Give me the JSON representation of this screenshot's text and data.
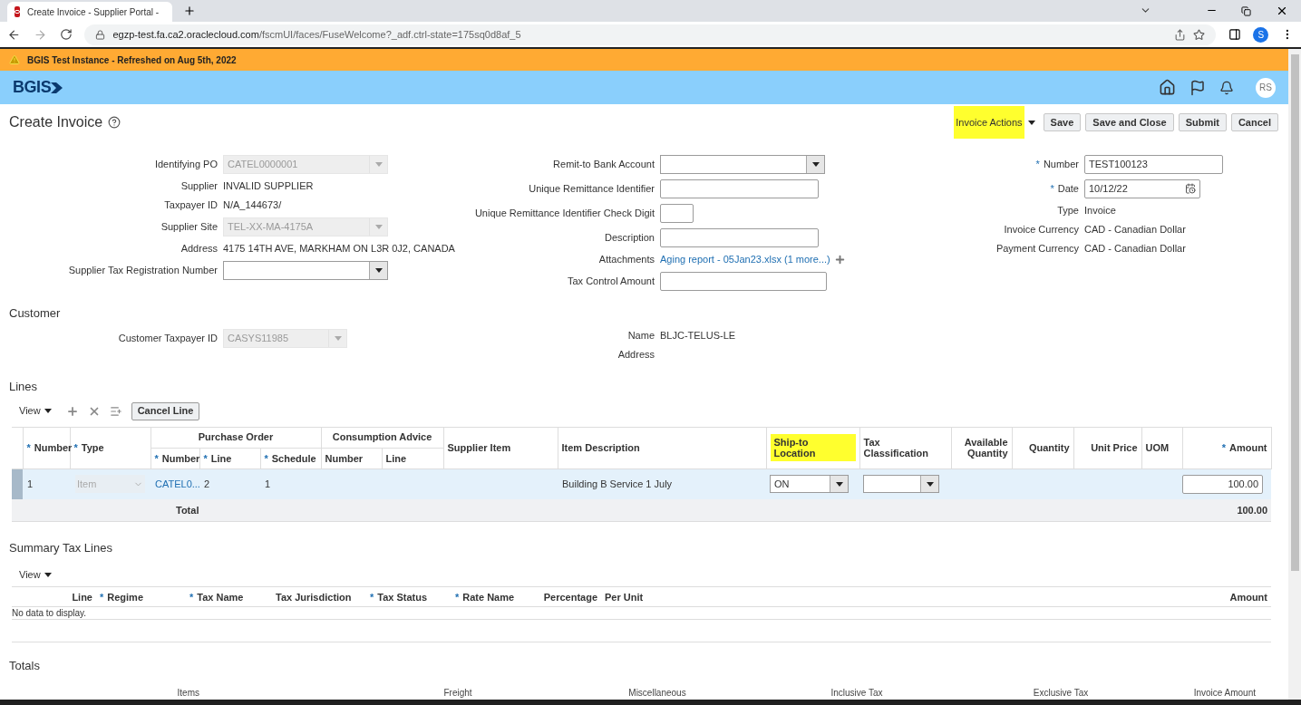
{
  "required_mark": "*",
  "browser": {
    "tab_title": "Create Invoice - Supplier Portal -",
    "url_host": "egzp-test.fa.ca2.oraclecloud.com",
    "url_path": "/fscmUI/faces/FuseWelcome?_adf.ctrl-state=175sq0d8af_5",
    "profile": "S"
  },
  "banner": {
    "text": "BGIS Test Instance - Refreshed on Aug 5th, 2022"
  },
  "header": {
    "logo": "BGIS",
    "avatar": "RS"
  },
  "page": {
    "title": "Create Invoice",
    "actions": [
      {
        "label": "Invoice Actions",
        "kind": "menu",
        "highlighted": true
      },
      {
        "label": "Save",
        "kind": "button",
        "highlighted": false
      },
      {
        "label": "Save and Close",
        "kind": "button",
        "highlighted": false
      },
      {
        "label": "Submit",
        "kind": "button",
        "highlighted": false
      },
      {
        "label": "Cancel",
        "kind": "button",
        "highlighted": false
      }
    ]
  },
  "form": {
    "columns": [
      [
        {
          "label": "Identifying PO",
          "kind": "select",
          "value": "CATEL0000001",
          "disabled": true,
          "required": false
        },
        {
          "label": "Supplier",
          "kind": "text",
          "value": "INVALID SUPPLIER",
          "required": false
        },
        {
          "label": "Taxpayer ID",
          "kind": "text",
          "value": "N/A_144673/",
          "required": false
        },
        {
          "label": "Supplier Site",
          "kind": "select",
          "value": "TEL-XX-MA-4175A",
          "disabled": true,
          "required": false
        },
        {
          "label": "Address",
          "kind": "text",
          "value": "4175 14TH AVE, MARKHAM ON L3R 0J2, CANADA",
          "required": false
        },
        {
          "label": "Supplier Tax Registration Number",
          "kind": "select",
          "disabled": false,
          "required": false
        }
      ],
      [
        {
          "label": "Remit-to Bank Account",
          "kind": "select",
          "disabled": false,
          "required": false
        },
        {
          "label": "Unique Remittance Identifier",
          "kind": "input",
          "required": false
        },
        {
          "label": "Unique Remittance Identifier Check Digit",
          "kind": "input",
          "required": false
        },
        {
          "label": "Description",
          "kind": "input",
          "required": false
        },
        {
          "label": "Attachments",
          "kind": "link",
          "value": "Aging report - 05Jan23.xlsx (1 more...)",
          "required": false
        },
        {
          "label": "Tax Control Amount",
          "kind": "input",
          "required": false
        }
      ],
      [
        {
          "label": "Number",
          "kind": "input",
          "value": "TEST100123",
          "required": true
        },
        {
          "label": "Date",
          "kind": "date",
          "value": "10/12/22",
          "required": true
        },
        {
          "label": "Type",
          "kind": "text",
          "value": "Invoice",
          "required": false
        },
        {
          "label": "Invoice Currency",
          "kind": "text",
          "value": "CAD - Canadian Dollar",
          "required": false
        },
        {
          "label": "Payment Currency",
          "kind": "text",
          "value": "CAD - Canadian Dollar",
          "required": false
        }
      ]
    ]
  },
  "customer": {
    "title": "Customer",
    "columns": [
      [
        {
          "label": "Customer Taxpayer ID",
          "kind": "select",
          "value": "CASYS11985",
          "disabled": true,
          "required": false
        }
      ],
      [
        {
          "label": "Name",
          "kind": "text",
          "value": "BLJC-TELUS-LE",
          "required": false
        },
        {
          "label": "Address",
          "kind": "text",
          "required": false
        }
      ]
    ]
  },
  "lines": {
    "title": "Lines",
    "view": "View",
    "cancel_button": "Cancel Line",
    "groups": [
      {
        "label": "Purchase Order"
      },
      {
        "label": "Consumption Advice"
      }
    ],
    "columns": [
      {
        "label": "Number",
        "required": true,
        "highlighted": false
      },
      {
        "label": "Type",
        "required": true,
        "highlighted": false
      },
      {
        "label": "Number",
        "required": true,
        "highlighted": false
      },
      {
        "label": "Line",
        "required": true,
        "highlighted": false
      },
      {
        "label": "Schedule",
        "required": true,
        "highlighted": false
      },
      {
        "label": "Number",
        "required": false,
        "highlighted": false
      },
      {
        "label": "Line",
        "required": false,
        "highlighted": false
      },
      {
        "label": "Supplier Item",
        "required": false,
        "highlighted": false
      },
      {
        "label": "Item Description",
        "required": false,
        "highlighted": false
      },
      {
        "label": "Ship-to Location",
        "required": false,
        "highlighted": true
      },
      {
        "label": "Tax Classification",
        "required": false,
        "highlighted": false
      },
      {
        "label": "Available Quantity",
        "required": false,
        "highlighted": false
      },
      {
        "label": "Quantity",
        "required": false,
        "highlighted": false
      },
      {
        "label": "Unit Price",
        "required": false,
        "highlighted": false
      },
      {
        "label": "UOM",
        "required": false,
        "highlighted": false
      },
      {
        "label": "Amount",
        "required": true,
        "highlighted": false
      }
    ],
    "rows": [
      {
        "selected": true,
        "number": "1",
        "type": "Item",
        "po_number": "CATEL0...",
        "po_line": "2",
        "po_schedule": "1",
        "item_description": "Building B Service 1 July",
        "ship_to": "ON",
        "amount": "100.00"
      }
    ],
    "total": {
      "label": "Total",
      "amount": "100.00"
    }
  },
  "tax_lines": {
    "title": "Summary Tax Lines",
    "view": "View",
    "columns": [
      {
        "label": "Line",
        "required": false
      },
      {
        "label": "Regime",
        "required": true
      },
      {
        "label": "Tax Name",
        "required": true
      },
      {
        "label": "Tax Jurisdiction",
        "required": false
      },
      {
        "label": "Tax Status",
        "required": true
      },
      {
        "label": "Rate Name",
        "required": true
      },
      {
        "label": "Percentage",
        "required": false
      },
      {
        "label": "Per Unit",
        "required": false
      },
      {
        "label": "Amount",
        "required": false
      }
    ],
    "empty": "No data to display."
  },
  "totals": {
    "title": "Totals",
    "columns": [
      "Items",
      "Freight",
      "Miscellaneous",
      "Inclusive Tax",
      "Exclusive Tax",
      "Invoice Amount"
    ]
  }
}
